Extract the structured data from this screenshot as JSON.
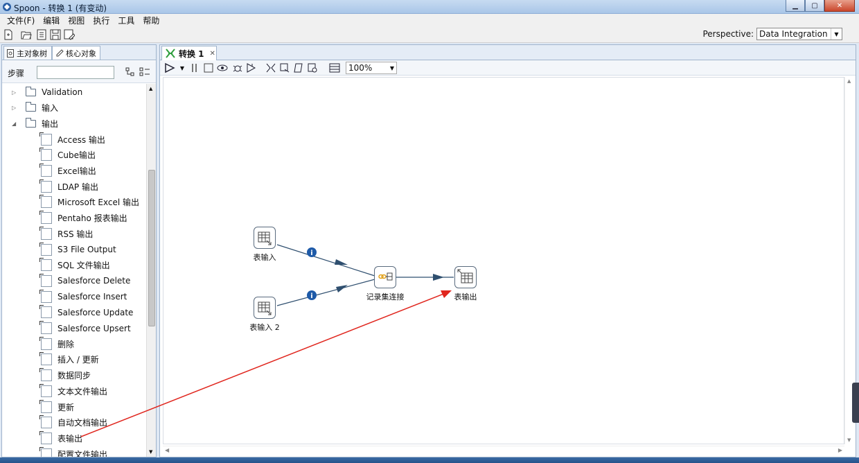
{
  "window": {
    "title": "Spoon - 转换 1 (有变动)",
    "controls": [
      "minimize",
      "maximize",
      "close"
    ]
  },
  "menu": [
    "文件(F)",
    "编辑",
    "视图",
    "执行",
    "工具",
    "帮助"
  ],
  "toolbar": {
    "icons": [
      "new-file-icon",
      "open-icon",
      "explore-icon",
      "save-icon",
      "save-as-icon"
    ],
    "perspective_label": "Perspective:",
    "perspective_value": "Data Integration"
  },
  "left_panel": {
    "tabs": [
      "主对象树",
      "核心对象"
    ],
    "steps_label": "步骤",
    "search_placeholder": "",
    "tree": [
      {
        "type": "folder",
        "label": "Validation",
        "expanded": false
      },
      {
        "type": "folder",
        "label": "输入",
        "expanded": false
      },
      {
        "type": "folder",
        "label": "输出",
        "expanded": true
      },
      {
        "type": "step",
        "label": "Access 输出",
        "icon": "access-output-icon"
      },
      {
        "type": "step",
        "label": "Cube输出",
        "icon": "cube-output-icon"
      },
      {
        "type": "step",
        "label": "Excel输出",
        "icon": "excel-output-icon"
      },
      {
        "type": "step",
        "label": "LDAP 输出",
        "icon": "ldap-output-icon"
      },
      {
        "type": "step",
        "label": "Microsoft Excel 输出",
        "icon": "ms-excel-output-icon"
      },
      {
        "type": "step",
        "label": "Pentaho 报表输出",
        "icon": "pentaho-report-icon"
      },
      {
        "type": "step",
        "label": "RSS 输出",
        "icon": "rss-output-icon"
      },
      {
        "type": "step",
        "label": "S3 File Output",
        "icon": "s3-output-icon"
      },
      {
        "type": "step",
        "label": "SQL 文件输出",
        "icon": "sql-file-output-icon"
      },
      {
        "type": "step",
        "label": "Salesforce Delete",
        "icon": "salesforce-delete-icon"
      },
      {
        "type": "step",
        "label": "Salesforce Insert",
        "icon": "salesforce-insert-icon"
      },
      {
        "type": "step",
        "label": "Salesforce Update",
        "icon": "salesforce-update-icon"
      },
      {
        "type": "step",
        "label": "Salesforce Upsert",
        "icon": "salesforce-upsert-icon"
      },
      {
        "type": "step",
        "label": "删除",
        "icon": "delete-step-icon"
      },
      {
        "type": "step",
        "label": "插入 / 更新",
        "icon": "insert-update-icon"
      },
      {
        "type": "step",
        "label": "数据同步",
        "icon": "data-sync-icon"
      },
      {
        "type": "step",
        "label": "文本文件输出",
        "icon": "text-file-output-icon"
      },
      {
        "type": "step",
        "label": "更新",
        "icon": "update-icon"
      },
      {
        "type": "step",
        "label": "自动文档输出",
        "icon": "auto-doc-icon"
      },
      {
        "type": "step",
        "label": "表输出",
        "icon": "table-output-icon"
      },
      {
        "type": "step",
        "label": "配置文件输出",
        "icon": "config-file-output-icon"
      }
    ]
  },
  "editor": {
    "tab_label": "转换 1",
    "zoom": "100%",
    "nodes": {
      "table_input_1": "表输入",
      "table_input_2": "表输入 2",
      "merge_join": "记录集连接",
      "table_output": "表输出"
    }
  },
  "colors": {
    "hop": "#2f4f6f",
    "info_badge": "#1e5aa8",
    "drag_arrow": "#e0261e"
  }
}
